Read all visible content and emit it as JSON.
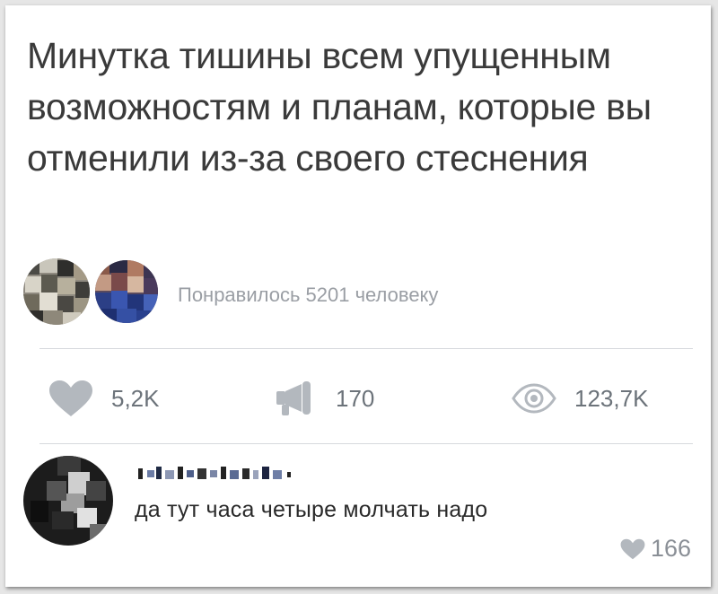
{
  "post": {
    "text": "Минутка тишины всем упущенным возможностям и планам, которые вы отменили из-за своего стеснения"
  },
  "likers": {
    "summary": "Понравилось 5201 человеку"
  },
  "stats": {
    "likes": {
      "icon": "heart-icon",
      "count": "5,2K"
    },
    "shares": {
      "icon": "megaphone-icon",
      "count": "170"
    },
    "views": {
      "icon": "eye-icon",
      "count": "123,7K"
    }
  },
  "comment": {
    "text": "да тут часа четыре молчать надо",
    "like_icon": "heart-icon",
    "likes": "166"
  },
  "colors": {
    "icon_gray": "#b3b8be",
    "stat_text": "#6c737a",
    "muted_text": "#9a9ea4"
  }
}
